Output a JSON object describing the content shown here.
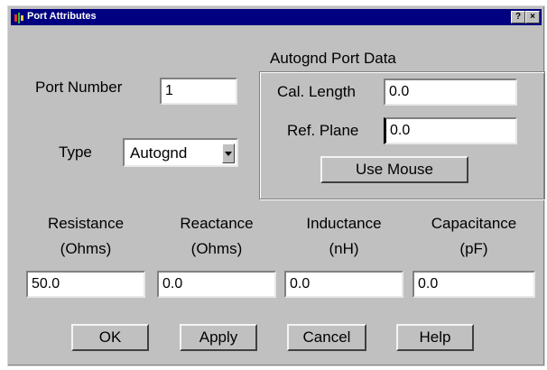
{
  "window": {
    "title": "Port Attributes",
    "help_glyph": "?",
    "close_glyph": "×"
  },
  "port": {
    "label": "Port Number",
    "value": "1"
  },
  "type": {
    "label": "Type",
    "value": "Autognd"
  },
  "autognd": {
    "group_label": "Autognd Port Data",
    "cal_length_label": "Cal. Length",
    "cal_length_value": "0.0",
    "ref_plane_label": "Ref. Plane",
    "ref_plane_value": "0.0",
    "use_mouse_label": "Use Mouse"
  },
  "params": [
    {
      "label": "Resistance",
      "unit": "(Ohms)",
      "value": "50.0"
    },
    {
      "label": "Reactance",
      "unit": "(Ohms)",
      "value": "0.0"
    },
    {
      "label": "Inductance",
      "unit": "(nH)",
      "value": "0.0"
    },
    {
      "label": "Capacitance",
      "unit": "(pF)",
      "value": "0.0"
    }
  ],
  "buttons": {
    "ok": "OK",
    "apply": "Apply",
    "cancel": "Cancel",
    "help": "Help"
  },
  "colors": {
    "titlebar": "#000080",
    "face": "#c0c0c0"
  }
}
